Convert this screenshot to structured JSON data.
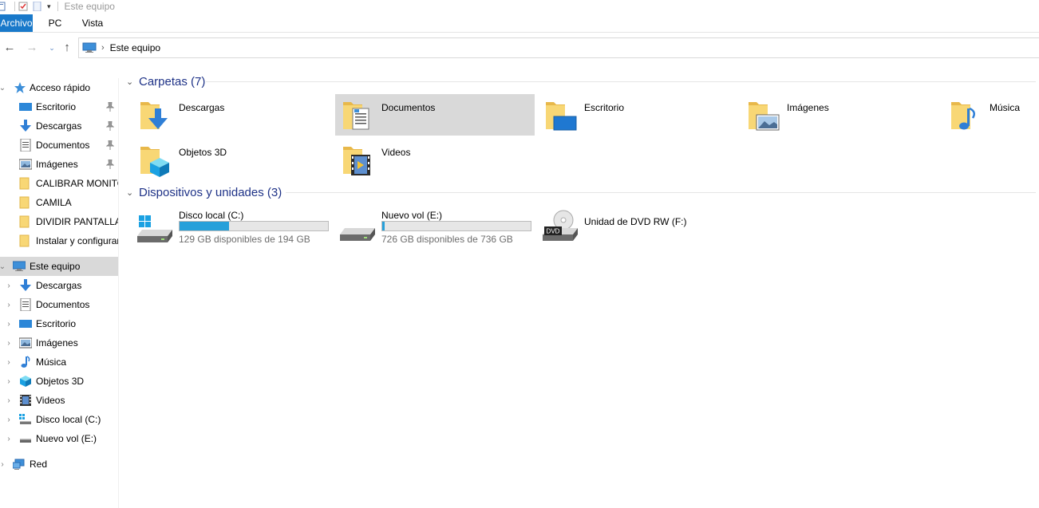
{
  "window": {
    "title": "Este equipo"
  },
  "ribbon": {
    "tabs": [
      {
        "label": "Archivo",
        "active": true
      },
      {
        "label": "PC",
        "active": false
      },
      {
        "label": "Vista",
        "active": false
      }
    ]
  },
  "address": {
    "breadcrumb": "Este equipo"
  },
  "nav": {
    "quick_access": {
      "label": "Acceso rápido",
      "items": [
        {
          "label": "Escritorio",
          "icon": "desktop-icon",
          "pinned": true
        },
        {
          "label": "Descargas",
          "icon": "download-icon",
          "pinned": true
        },
        {
          "label": "Documentos",
          "icon": "documents-icon",
          "pinned": true
        },
        {
          "label": "Imágenes",
          "icon": "pictures-icon",
          "pinned": true
        },
        {
          "label": "CALIBRAR MONITOR",
          "icon": "folder-icon",
          "pinned": false
        },
        {
          "label": "CAMILA",
          "icon": "folder-icon",
          "pinned": false
        },
        {
          "label": "DIVIDIR PANTALLA",
          "icon": "folder-icon",
          "pinned": false
        },
        {
          "label": "Instalar y configurar",
          "icon": "folder-icon",
          "pinned": false
        }
      ]
    },
    "this_pc": {
      "label": "Este equipo",
      "items": [
        {
          "label": "Descargas",
          "icon": "download-icon"
        },
        {
          "label": "Documentos",
          "icon": "documents-icon"
        },
        {
          "label": "Escritorio",
          "icon": "desktop-icon"
        },
        {
          "label": "Imágenes",
          "icon": "pictures-icon"
        },
        {
          "label": "Música",
          "icon": "music-icon"
        },
        {
          "label": "Objetos 3D",
          "icon": "3d-objects-icon"
        },
        {
          "label": "Videos",
          "icon": "videos-icon"
        },
        {
          "label": "Disco local (C:)",
          "icon": "windows-drive-icon"
        },
        {
          "label": "Nuevo vol (E:)",
          "icon": "drive-icon"
        }
      ]
    },
    "network": {
      "label": "Red"
    }
  },
  "content": {
    "folders": {
      "header": "Carpetas (7)",
      "items": [
        {
          "label": "Descargas",
          "icon": "download-folder-icon"
        },
        {
          "label": "Documentos",
          "icon": "documents-folder-icon"
        },
        {
          "label": "Escritorio",
          "icon": "desktop-folder-icon"
        },
        {
          "label": "Imágenes",
          "icon": "pictures-folder-icon"
        },
        {
          "label": "Música",
          "icon": "music-folder-icon"
        },
        {
          "label": "Objetos 3D",
          "icon": "3d-objects-folder-icon"
        },
        {
          "label": "Videos",
          "icon": "videos-folder-icon"
        }
      ]
    },
    "devices": {
      "header": "Dispositivos y unidades (3)",
      "items": [
        {
          "label": "Disco local (C:)",
          "free_text": "129 GB disponibles de 194 GB",
          "used_fraction": 0.335,
          "icon": "windows-drive-icon"
        },
        {
          "label": "Nuevo vol (E:)",
          "free_text": "726 GB disponibles de 736 GB",
          "used_fraction": 0.014,
          "icon": "drive-icon"
        },
        {
          "label": "Unidad de DVD RW (F:)",
          "badge": "DVD",
          "icon": "dvd-drive-icon"
        }
      ]
    }
  },
  "colors": {
    "accent": "#1979ca",
    "header_text": "#1e3287",
    "selection": "#d9d9d9",
    "bar_fill": "#26a0da",
    "folder": "#f8d775"
  }
}
